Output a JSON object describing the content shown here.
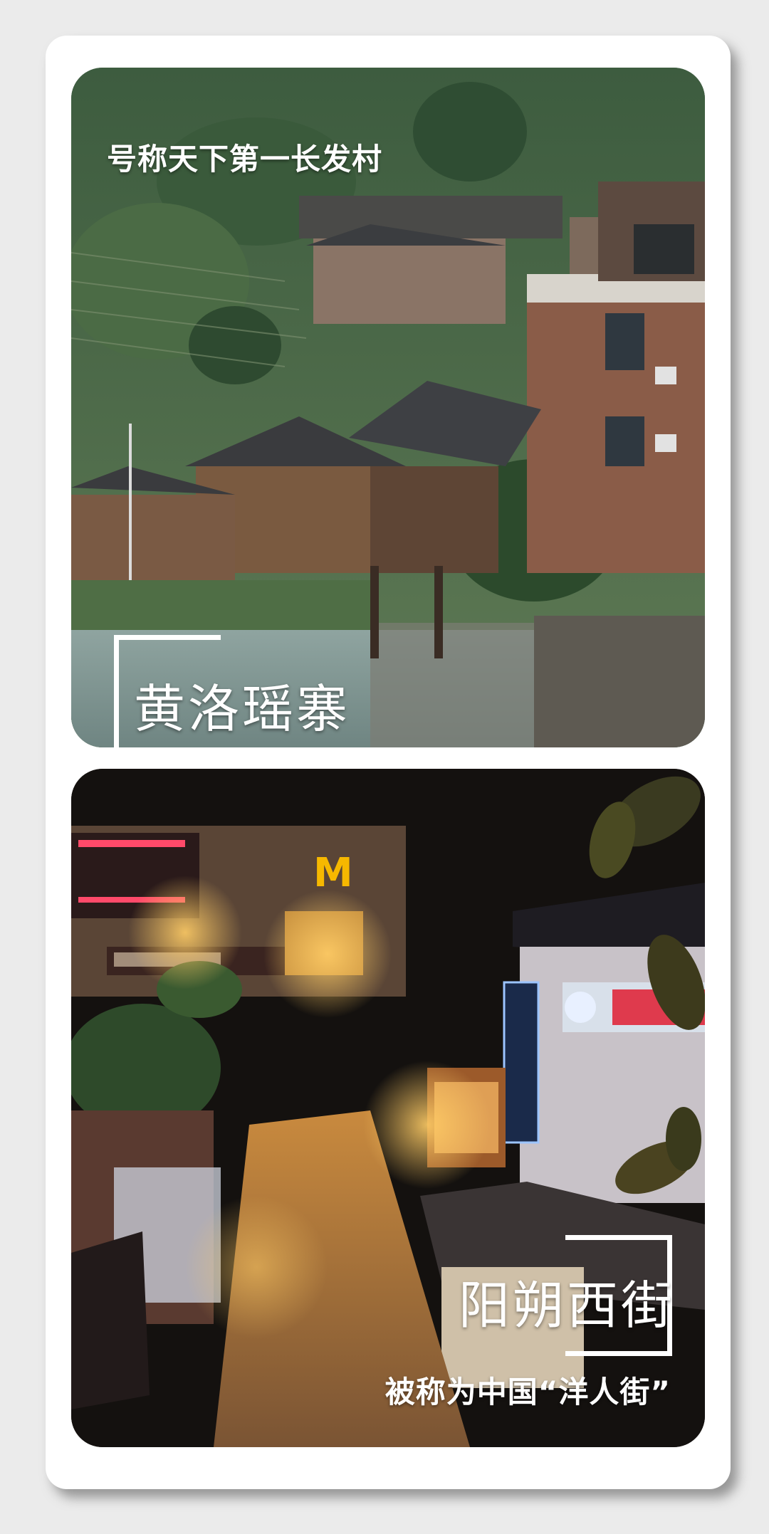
{
  "cards": [
    {
      "caption": "号称天下第一长发村",
      "place_name": "黄洛瑶寨"
    },
    {
      "caption": "被称为中国“洋人街”",
      "place_name": "阳朔西街"
    }
  ]
}
